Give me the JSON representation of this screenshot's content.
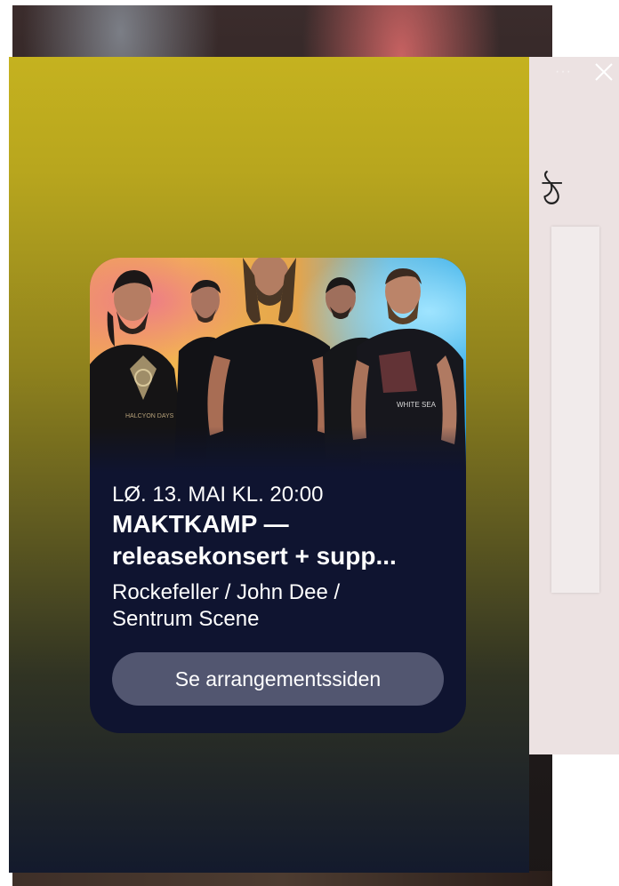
{
  "story": {
    "event": {
      "date": "LØ. 13. MAI KL. 20:00",
      "title_line1": "MAKTKAMP —",
      "title_line2": "releasekonsert + supp...",
      "venue_line1": "Rockefeller / John Dee /",
      "venue_line2": "Sentrum Scene",
      "button_label": "Se arrangementssiden"
    },
    "band_photo": {
      "shirt_print_1": "HALCYON DAYS",
      "shirt_print_2": "WHITE SEA"
    }
  },
  "side_panel": {
    "more_icon": "more-icon",
    "close_icon": "close-icon",
    "partial_text": "ঠ"
  },
  "colors": {
    "gradient_top": "#c5b21f",
    "gradient_bottom": "#131a2d",
    "card_bg": "#0f1430",
    "button_bg": "#525670"
  }
}
